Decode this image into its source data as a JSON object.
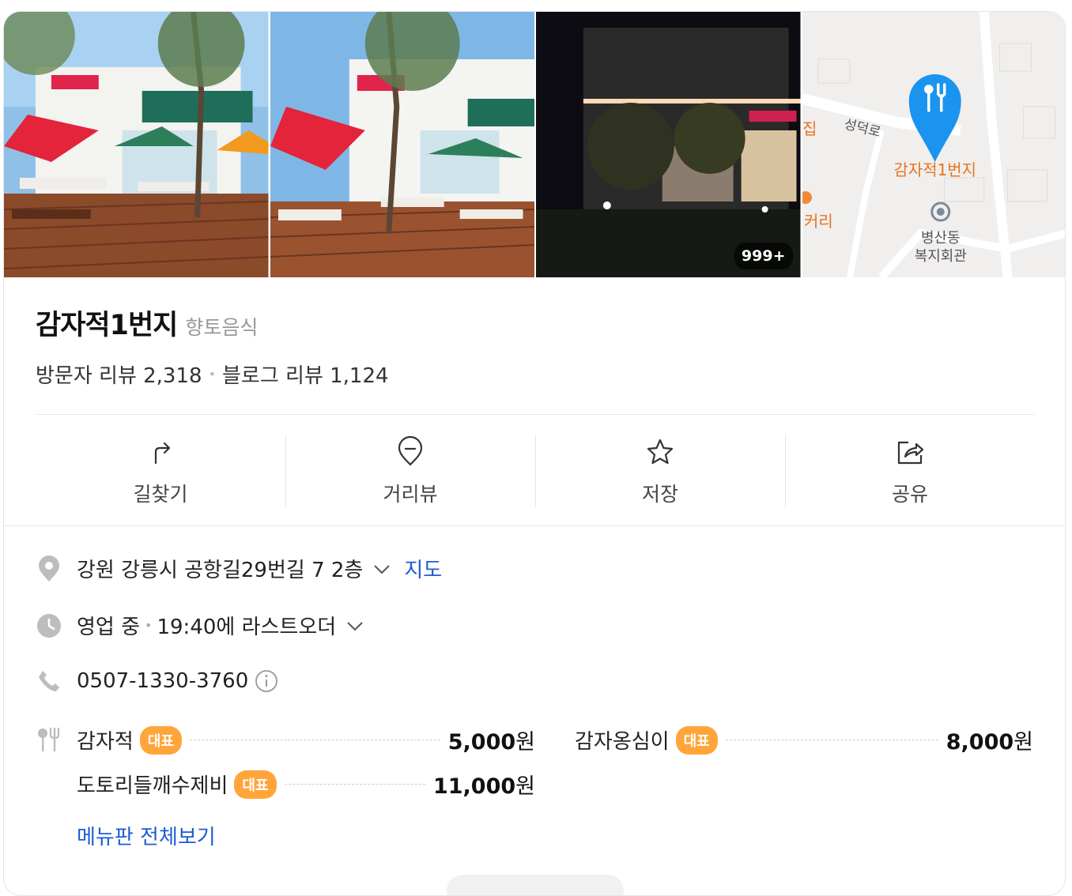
{
  "photos": {
    "more_count": "999+"
  },
  "map_thumb": {
    "road_label": "성덕로",
    "place_label": "감자적1번지",
    "poi_label_line1": "병산동",
    "poi_label_line2": "복지회관",
    "left_label_top": "집",
    "left_label_bottom": "커리",
    "pin_color": "#1b94f0"
  },
  "place": {
    "name": "감자적1번지",
    "category": "향토음식",
    "visitor_reviews": "방문자 리뷰 2,318",
    "blog_reviews": "블로그 리뷰 1,124"
  },
  "actions": [
    {
      "label": "길찾기",
      "icon": "directions-icon"
    },
    {
      "label": "거리뷰",
      "icon": "street-view-icon"
    },
    {
      "label": "저장",
      "icon": "star-icon"
    },
    {
      "label": "공유",
      "icon": "share-icon"
    }
  ],
  "info": {
    "address": "강원 강릉시 공항길29번길 7 2층",
    "map_link": "지도",
    "status": "영업 중",
    "last_order": "19:40에 라스트오더",
    "phone": "0507-1330-3760"
  },
  "menu": {
    "badge": "대표",
    "items": [
      {
        "name": "감자적",
        "price": "5,000",
        "unit": "원"
      },
      {
        "name": "감자옹심이",
        "price": "8,000",
        "unit": "원"
      },
      {
        "name": "도토리들깨수제비",
        "price": "11,000",
        "unit": "원"
      }
    ],
    "see_all": "메뉴판 전체보기"
  },
  "colors": {
    "link": "#1d5bd6",
    "badge": "#ffa53a"
  }
}
